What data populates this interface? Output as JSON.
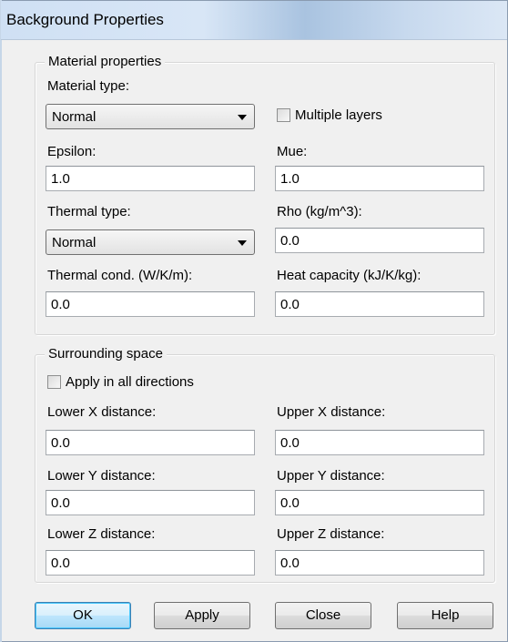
{
  "window": {
    "title": "Background Properties"
  },
  "material": {
    "group_label": "Material properties",
    "material_type_label": "Material type:",
    "material_type_value": "Normal",
    "multiple_layers_label": "Multiple layers",
    "multiple_layers_checked": false,
    "epsilon_label": "Epsilon:",
    "epsilon_value": "1.0",
    "mue_label": "Mue:",
    "mue_value": "1.0",
    "thermal_type_label": "Thermal type:",
    "thermal_type_value": "Normal",
    "rho_label": "Rho (kg/m^3):",
    "rho_value": "0.0",
    "thermal_cond_label": "Thermal cond. (W/K/m):",
    "thermal_cond_value": "0.0",
    "heat_capacity_label": "Heat capacity (kJ/K/kg):",
    "heat_capacity_value": "0.0"
  },
  "surrounding": {
    "group_label": "Surrounding space",
    "apply_all_label": "Apply in all directions",
    "apply_all_checked": false,
    "lower_x_label": "Lower X distance:",
    "lower_x_value": "0.0",
    "upper_x_label": "Upper X distance:",
    "upper_x_value": "0.0",
    "lower_y_label": "Lower Y distance:",
    "lower_y_value": "0.0",
    "upper_y_label": "Upper Y distance:",
    "upper_y_value": "0.0",
    "lower_z_label": "Lower Z distance:",
    "lower_z_value": "0.0",
    "upper_z_label": "Upper Z distance:",
    "upper_z_value": "0.0"
  },
  "buttons": {
    "ok": "OK",
    "apply": "Apply",
    "close": "Close",
    "help": "Help"
  }
}
